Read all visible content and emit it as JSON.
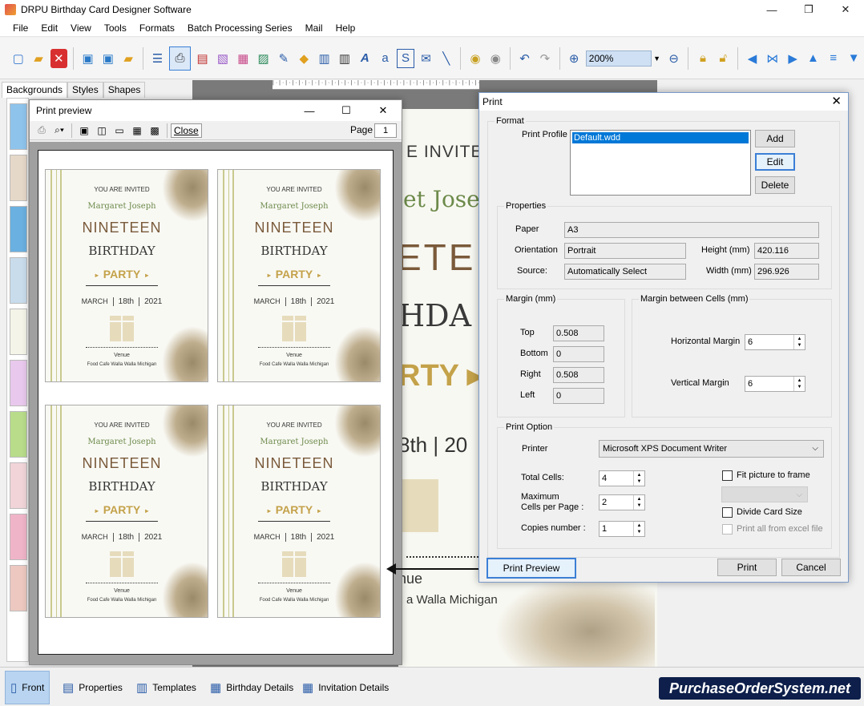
{
  "app": {
    "title": "DRPU Birthday Card Designer Software",
    "window_controls": [
      "—",
      "❐",
      "✕"
    ]
  },
  "menu": [
    "File",
    "Edit",
    "View",
    "Tools",
    "Formats",
    "Batch Processing Series",
    "Mail",
    "Help"
  ],
  "toolbar": {
    "zoom_value": "200%",
    "icons": [
      "new-icon",
      "open-icon",
      "close-icon",
      "save-icon",
      "save-as-icon",
      "export-icon",
      "properties-icon",
      "print-icon",
      "copy-icon",
      "image-icon",
      "gift-icon",
      "picture-icon",
      "pen-icon",
      "shape-icon",
      "barcode-icon",
      "barcode2-icon",
      "text-icon",
      "text-a-icon",
      "signature-icon",
      "mail-icon",
      "line-icon",
      "database-icon",
      "database2-icon",
      "undo-icon",
      "redo-icon",
      "zoom-in-icon",
      "zoom-out-icon",
      "lock-icon",
      "unlock-icon",
      "arrow-left-icon",
      "flip-icon",
      "arrow-right-icon",
      "arrow-up-icon",
      "align-icon",
      "arrow-down-icon"
    ]
  },
  "left_tabs": [
    "Backgrounds",
    "Styles",
    "Shapes"
  ],
  "canvas_text": {
    "invited": "E INVITED",
    "name": "et Joseph",
    "nineteen": "ETEE",
    "birthday": "HDA",
    "party": "RTY ▸",
    "date": "8th  |  20",
    "venue": "nue",
    "address": "a Walla Michigan"
  },
  "print_preview": {
    "title": "Print preview",
    "close_label": "Close",
    "page_label": "Page",
    "page_value": "1",
    "card": {
      "invited": "YOU ARE INVITED",
      "name": "Margaret Joseph",
      "nineteen": "NINETEEN",
      "birthday": "BIRTHDAY",
      "party": "PARTY",
      "month": "MARCH",
      "day": "18th",
      "year": "2021",
      "venue": "Venue",
      "address": "Food  Cafe Walla Walla Michigan"
    }
  },
  "print_dialog": {
    "title": "Print",
    "format": {
      "group": "Format",
      "profile_label": "Print Profile",
      "profile_selected": "Default.wdd",
      "add": "Add",
      "edit": "Edit",
      "delete": "Delete"
    },
    "properties": {
      "group": "Properties",
      "paper_label": "Paper",
      "paper_value": "A3",
      "orientation_label": "Orientation",
      "orientation_value": "Portrait",
      "height_label": "Height (mm)",
      "height_value": "420.116",
      "source_label": "Source:",
      "source_value": "Automatically Select",
      "width_label": "Width (mm)",
      "width_value": "296.926"
    },
    "margin": {
      "group": "Margin (mm)",
      "top_label": "Top",
      "top_value": "0.508",
      "bottom_label": "Bottom",
      "bottom_value": "0",
      "right_label": "Right",
      "right_value": "0.508",
      "left_label": "Left",
      "left_value": "0"
    },
    "cell_margin": {
      "group": "Margin between Cells (mm)",
      "horizontal_label": "Horizontal Margin",
      "horizontal_value": "6",
      "vertical_label": "Vertical Margin",
      "vertical_value": "6"
    },
    "print_option": {
      "group": "Print Option",
      "printer_label": "Printer",
      "printer_value": "Microsoft XPS Document Writer",
      "total_cells_label": "Total Cells:",
      "total_cells_value": "4",
      "max_cells_label_1": "Maximum",
      "max_cells_label_2": "Cells per Page :",
      "max_cells_value": "2",
      "copies_label": "Copies number :",
      "copies_value": "1",
      "fit_picture_label": "Fit picture to frame",
      "divide_card_label": "Divide Card Size",
      "print_excel_label": "Print all from excel file"
    },
    "print_preview_button": "Print Preview",
    "print_button": "Print",
    "cancel_button": "Cancel"
  },
  "bottom_tabs": [
    "Front",
    "Properties",
    "Templates",
    "Birthday Details",
    "Invitation Details"
  ],
  "brand": "PurchaseOrderSystem.net"
}
